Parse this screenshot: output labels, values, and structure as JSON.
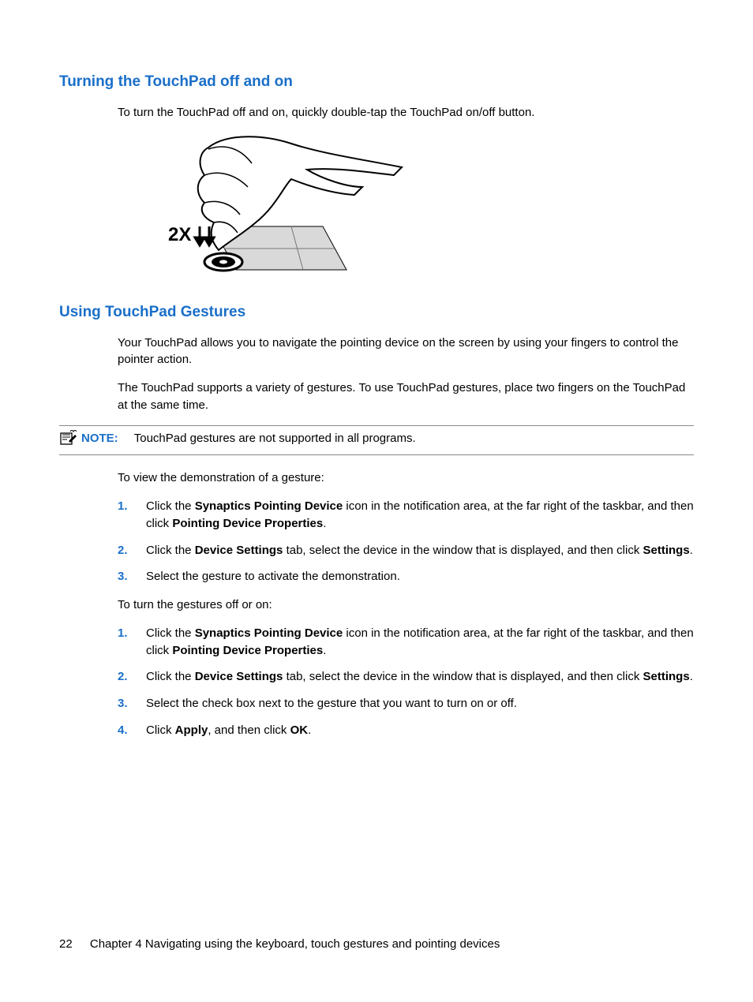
{
  "section1": {
    "heading": "Turning the TouchPad off and on",
    "para": "To turn the TouchPad off and on, quickly double-tap the TouchPad on/off button.",
    "illus_label": "2X"
  },
  "section2": {
    "heading": "Using TouchPad Gestures",
    "para1": "Your TouchPad allows you to navigate the pointing device on the screen by using your fingers to control the pointer action.",
    "para2": "The TouchPad supports a variety of gestures. To use TouchPad gestures, place two fingers on the TouchPad at the same time.",
    "note_label": "NOTE:",
    "note_text": "TouchPad gestures are not supported in all programs.",
    "para3": "To view the demonstration of a gesture:",
    "list1": {
      "1": {
        "n": "1.",
        "pre": "Click the ",
        "b1": "Synaptics Pointing Device",
        "mid": " icon in the notification area, at the far right of the taskbar, and then click ",
        "b2": "Pointing Device Properties",
        "post": "."
      },
      "2": {
        "n": "2.",
        "pre": "Click the ",
        "b1": "Device Settings",
        "mid": " tab, select the device in the window that is displayed, and then click ",
        "b2": "Settings",
        "post": "."
      },
      "3": {
        "n": "3.",
        "text": "Select the gesture to activate the demonstration."
      }
    },
    "para4": "To turn the gestures off or on:",
    "list2": {
      "1": {
        "n": "1.",
        "pre": "Click the ",
        "b1": "Synaptics Pointing Device",
        "mid": " icon in the notification area, at the far right of the taskbar, and then click ",
        "b2": "Pointing Device Properties",
        "post": "."
      },
      "2": {
        "n": "2.",
        "pre": "Click the ",
        "b1": "Device Settings",
        "mid": " tab, select the device in the window that is displayed, and then click ",
        "b2": "Settings",
        "post": "."
      },
      "3": {
        "n": "3.",
        "text": "Select the check box next to the gesture that you want to turn on or off."
      },
      "4": {
        "n": "4.",
        "pre": "Click ",
        "b1": "Apply",
        "mid": ", and then click ",
        "b2": "OK",
        "post": "."
      }
    }
  },
  "footer": {
    "page_num": "22",
    "chapter": "Chapter 4   Navigating using the keyboard, touch gestures and pointing devices"
  }
}
